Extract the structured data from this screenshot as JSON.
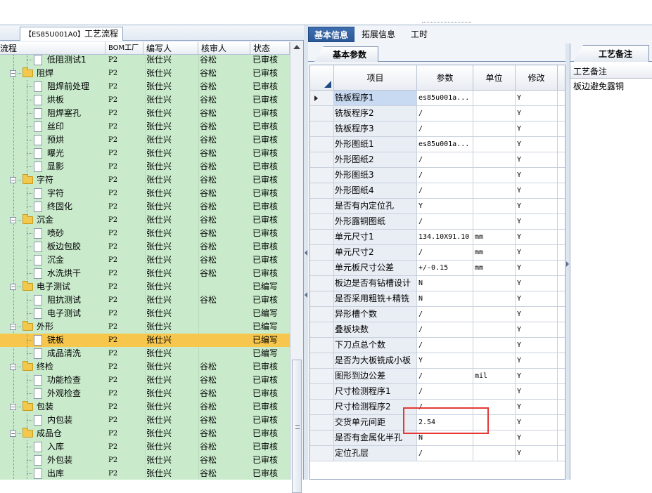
{
  "left_panel": {
    "tab_code": "【ES85U001A0】",
    "tab_title": "工艺流程",
    "columns": [
      "流程",
      "BOM工厂",
      "编写人",
      "核审人",
      "状态"
    ],
    "rows": [
      {
        "level": 2,
        "kind": "doc",
        "name": "低阻测试1",
        "bom": "P2",
        "writer": "张仕兴",
        "reviewer": "谷松",
        "status": "已审核"
      },
      {
        "level": 1,
        "kind": "folder",
        "name": "阻焊",
        "bom": "P2",
        "writer": "张仕兴",
        "reviewer": "谷松",
        "status": "已审核"
      },
      {
        "level": 2,
        "kind": "doc",
        "name": "阻焊前处理",
        "bom": "P2",
        "writer": "张仕兴",
        "reviewer": "谷松",
        "status": "已审核"
      },
      {
        "level": 2,
        "kind": "doc",
        "name": "烘板",
        "bom": "P2",
        "writer": "张仕兴",
        "reviewer": "谷松",
        "status": "已审核"
      },
      {
        "level": 2,
        "kind": "doc",
        "name": "阻焊塞孔",
        "bom": "P2",
        "writer": "张仕兴",
        "reviewer": "谷松",
        "status": "已审核"
      },
      {
        "level": 2,
        "kind": "doc",
        "name": "丝印",
        "bom": "P2",
        "writer": "张仕兴",
        "reviewer": "谷松",
        "status": "已审核"
      },
      {
        "level": 2,
        "kind": "doc",
        "name": "预烘",
        "bom": "P2",
        "writer": "张仕兴",
        "reviewer": "谷松",
        "status": "已审核"
      },
      {
        "level": 2,
        "kind": "doc",
        "name": "曝光",
        "bom": "P2",
        "writer": "张仕兴",
        "reviewer": "谷松",
        "status": "已审核"
      },
      {
        "level": 2,
        "kind": "doc",
        "name": "显影",
        "bom": "P2",
        "writer": "张仕兴",
        "reviewer": "谷松",
        "status": "已审核"
      },
      {
        "level": 1,
        "kind": "folder",
        "name": "字符",
        "bom": "P2",
        "writer": "张仕兴",
        "reviewer": "谷松",
        "status": "已审核"
      },
      {
        "level": 2,
        "kind": "doc",
        "name": "字符",
        "bom": "P2",
        "writer": "张仕兴",
        "reviewer": "谷松",
        "status": "已审核"
      },
      {
        "level": 2,
        "kind": "doc",
        "name": "终固化",
        "bom": "P2",
        "writer": "张仕兴",
        "reviewer": "谷松",
        "status": "已审核"
      },
      {
        "level": 1,
        "kind": "folder",
        "name": "沉金",
        "bom": "P2",
        "writer": "张仕兴",
        "reviewer": "谷松",
        "status": "已审核"
      },
      {
        "level": 2,
        "kind": "doc",
        "name": "喷砂",
        "bom": "P2",
        "writer": "张仕兴",
        "reviewer": "谷松",
        "status": "已审核"
      },
      {
        "level": 2,
        "kind": "doc",
        "name": "板边包胶",
        "bom": "P2",
        "writer": "张仕兴",
        "reviewer": "谷松",
        "status": "已审核"
      },
      {
        "level": 2,
        "kind": "doc",
        "name": "沉金",
        "bom": "P2",
        "writer": "张仕兴",
        "reviewer": "谷松",
        "status": "已审核"
      },
      {
        "level": 2,
        "kind": "doc",
        "name": "水洗烘干",
        "bom": "P2",
        "writer": "张仕兴",
        "reviewer": "谷松",
        "status": "已审核"
      },
      {
        "level": 1,
        "kind": "folder",
        "name": "电子测试",
        "bom": "P2",
        "writer": "张仕兴",
        "reviewer": "",
        "status": "已编写"
      },
      {
        "level": 2,
        "kind": "doc",
        "name": "阻抗测试",
        "bom": "P2",
        "writer": "张仕兴",
        "reviewer": "谷松",
        "status": "已审核"
      },
      {
        "level": 2,
        "kind": "doc",
        "name": "电子测试",
        "bom": "P2",
        "writer": "张仕兴",
        "reviewer": "",
        "status": "已编写"
      },
      {
        "level": 1,
        "kind": "folder",
        "name": "外形",
        "bom": "P2",
        "writer": "张仕兴",
        "reviewer": "",
        "status": "已编写"
      },
      {
        "level": 2,
        "kind": "doc",
        "name": "铣板",
        "bom": "P2",
        "writer": "张仕兴",
        "reviewer": "",
        "status": "已编写",
        "selected": true
      },
      {
        "level": 2,
        "kind": "doc",
        "name": "成品清洗",
        "bom": "P2",
        "writer": "张仕兴",
        "reviewer": "",
        "status": "已编写"
      },
      {
        "level": 1,
        "kind": "folder",
        "name": "终检",
        "bom": "P2",
        "writer": "张仕兴",
        "reviewer": "谷松",
        "status": "已审核"
      },
      {
        "level": 2,
        "kind": "doc",
        "name": "功能检查",
        "bom": "P2",
        "writer": "张仕兴",
        "reviewer": "谷松",
        "status": "已审核"
      },
      {
        "level": 2,
        "kind": "doc",
        "name": "外观检查",
        "bom": "P2",
        "writer": "张仕兴",
        "reviewer": "谷松",
        "status": "已审核"
      },
      {
        "level": 1,
        "kind": "folder",
        "name": "包装",
        "bom": "P2",
        "writer": "张仕兴",
        "reviewer": "谷松",
        "status": "已审核"
      },
      {
        "level": 2,
        "kind": "doc",
        "name": "内包装",
        "bom": "P2",
        "writer": "张仕兴",
        "reviewer": "谷松",
        "status": "已审核"
      },
      {
        "level": 1,
        "kind": "folder",
        "name": "成品仓",
        "bom": "P2",
        "writer": "张仕兴",
        "reviewer": "谷松",
        "status": "已审核"
      },
      {
        "level": 2,
        "kind": "doc",
        "name": "入库",
        "bom": "P2",
        "writer": "张仕兴",
        "reviewer": "谷松",
        "status": "已审核"
      },
      {
        "level": 2,
        "kind": "doc",
        "name": "外包装",
        "bom": "P2",
        "writer": "张仕兴",
        "reviewer": "谷松",
        "status": "已审核"
      },
      {
        "level": 2,
        "kind": "doc",
        "name": "出库",
        "bom": "P2",
        "writer": "张仕兴",
        "reviewer": "谷松",
        "status": "已审核"
      }
    ]
  },
  "main_tabs": [
    "基本信息",
    "拓展信息",
    "工时"
  ],
  "sub_tab": "基本参数",
  "grid": {
    "columns": [
      "项目",
      "参数",
      "单位",
      "修改"
    ],
    "rows": [
      {
        "item": "铣板程序1",
        "param": "es85u001a...",
        "unit": "",
        "mod": "Y",
        "current": true
      },
      {
        "item": "铣板程序2",
        "param": "/",
        "unit": "",
        "mod": "Y"
      },
      {
        "item": "铣板程序3",
        "param": "/",
        "unit": "",
        "mod": "Y"
      },
      {
        "item": "外形图纸1",
        "param": "es85u001a...",
        "unit": "",
        "mod": "Y"
      },
      {
        "item": "外形图纸2",
        "param": "/",
        "unit": "",
        "mod": "Y"
      },
      {
        "item": "外形图纸3",
        "param": "/",
        "unit": "",
        "mod": "Y"
      },
      {
        "item": "外形图纸4",
        "param": "/",
        "unit": "",
        "mod": "Y"
      },
      {
        "item": "是否有内定位孔",
        "param": "Y",
        "unit": "",
        "mod": "Y"
      },
      {
        "item": "外形露铜图纸",
        "param": "/",
        "unit": "",
        "mod": "Y"
      },
      {
        "item": "单元尺寸1",
        "param": "134.10X91.10",
        "unit": "mm",
        "mod": "Y"
      },
      {
        "item": "单元尺寸2",
        "param": "/",
        "unit": "mm",
        "mod": "Y"
      },
      {
        "item": "单元板尺寸公差",
        "param": "+/-0.15",
        "unit": "mm",
        "mod": "Y"
      },
      {
        "item": "板边是否有钻槽设计",
        "param": "N",
        "unit": "",
        "mod": "Y"
      },
      {
        "item": "是否采用粗铣+精铣",
        "param": "N",
        "unit": "",
        "mod": "Y"
      },
      {
        "item": "异形槽个数",
        "param": "/",
        "unit": "",
        "mod": "Y"
      },
      {
        "item": "叠板块数",
        "param": "/",
        "unit": "",
        "mod": "Y"
      },
      {
        "item": "下刀点总个数",
        "param": "/",
        "unit": "",
        "mod": "Y"
      },
      {
        "item": "是否为大板铣成小板",
        "param": "Y",
        "unit": "",
        "mod": "Y"
      },
      {
        "item": "图形到边公差",
        "param": "/",
        "unit": "mil",
        "mod": "Y"
      },
      {
        "item": "尺寸检测程序1",
        "param": "/",
        "unit": "",
        "mod": "Y"
      },
      {
        "item": "尺寸检测程序2",
        "param": "/",
        "unit": "",
        "mod": "Y"
      },
      {
        "item": "交货单元间距",
        "param": "2.54",
        "unit": "",
        "mod": "Y"
      },
      {
        "item": "是否有金属化半孔",
        "param": "N",
        "unit": "",
        "mod": "Y"
      },
      {
        "item": "定位孔层",
        "param": "/",
        "unit": "",
        "mod": "Y"
      }
    ]
  },
  "right_panel": {
    "tab": "工艺备注",
    "header": "工艺备注",
    "text": "板边避免露铜"
  },
  "colors": {
    "tree_bg": "#c9ebcc",
    "selected_row": "#f7c64c",
    "active_tab": "#2c5896",
    "annotation": "#e53935"
  }
}
